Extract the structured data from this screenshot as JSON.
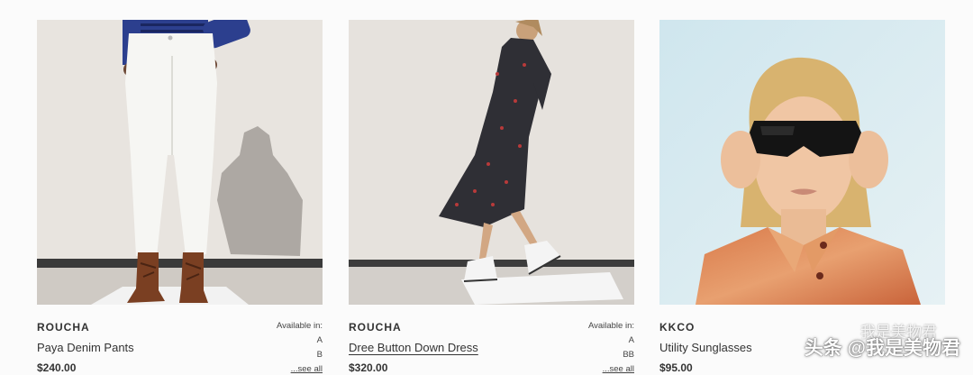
{
  "products": [
    {
      "brand": "ROUCHA",
      "name": "Paya Denim Pants",
      "price": "$240.00",
      "availability_label": "Available in:",
      "sizes": [
        "A",
        "B"
      ],
      "see_all": "...see all"
    },
    {
      "brand": "ROUCHA",
      "name": "Dree Button Down Dress",
      "price": "$320.00",
      "availability_label": "Available in:",
      "sizes": [
        "A",
        "BB"
      ],
      "see_all": "...see all"
    },
    {
      "brand": "KKCO",
      "name": "Utility Sunglasses",
      "price": "$95.00"
    }
  ],
  "watermark": {
    "mark": "我是美物君",
    "text": "头条 @我是美物君"
  }
}
